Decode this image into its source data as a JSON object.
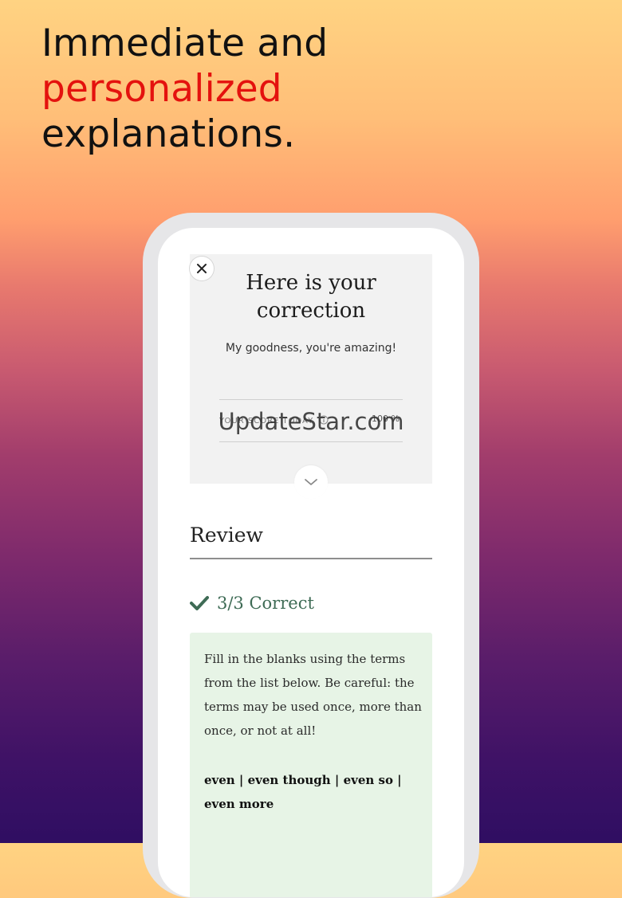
{
  "headline": {
    "line1": "Immediate and",
    "line2": "personalized",
    "line3": "explanations."
  },
  "colors": {
    "accent": "#e4120e",
    "correct_green": "#3e6b55",
    "card_green": "#e7f4e6"
  },
  "correction": {
    "title": "Here is your correction",
    "subtitle": "My goodness, you're amazing!",
    "score_label": "YOUR SCORE TODAY",
    "score_value": "100 %",
    "watermark": "UpdateStar.com"
  },
  "icons": {
    "close": "close-icon",
    "info": "info-icon",
    "expand": "chevron-down-icon",
    "check": "check-icon"
  },
  "review": {
    "title": "Review",
    "result": "3/3 Correct",
    "question": "Fill in the blanks using the terms from the list below. Be careful: the terms may be used once, more than once, or not at all!",
    "options": "even | even though | even so | even more"
  }
}
